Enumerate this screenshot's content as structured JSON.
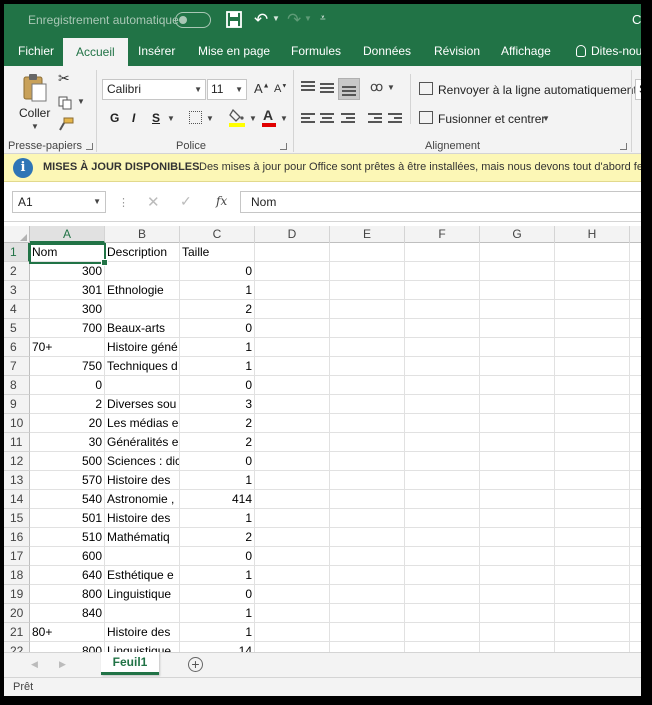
{
  "titlebar": {
    "autosave_label": "Enregistrement automatique",
    "title_partial": "C"
  },
  "tabs": [
    {
      "label": "Fichier",
      "active": false
    },
    {
      "label": "Accueil",
      "active": true
    },
    {
      "label": "Insérer",
      "active": false
    },
    {
      "label": "Mise en page",
      "active": false
    },
    {
      "label": "Formules",
      "active": false
    },
    {
      "label": "Données",
      "active": false
    },
    {
      "label": "Révision",
      "active": false
    },
    {
      "label": "Affichage",
      "active": false
    },
    {
      "label": "Dites-nou",
      "active": false
    }
  ],
  "ribbon": {
    "clipboard": {
      "paste_label": "Coller",
      "group_label": "Presse-papiers"
    },
    "font": {
      "font_name": "Calibri",
      "font_size": "11",
      "bold": "G",
      "italic": "I",
      "underline": "S",
      "group_label": "Police"
    },
    "alignment": {
      "wrap_label": "Renvoyer à la ligne automatiquement",
      "merge_label": "Fusionner et centrer",
      "group_label": "Alignement"
    },
    "number": {
      "format_partial": "S"
    }
  },
  "message_bar": {
    "title": "MISES À JOUR DISPONIBLES",
    "text": "Des mises à jour pour Office sont prêtes à être installées, mais nous devons tout d'abord fe"
  },
  "formula_bar": {
    "name_box": "A1",
    "content": "Nom"
  },
  "grid": {
    "columns": [
      "A",
      "B",
      "C",
      "D",
      "E",
      "F",
      "G",
      "H"
    ],
    "rows": [
      {
        "n": "1",
        "a": "Nom",
        "b": "Description",
        "c": "Taille"
      },
      {
        "n": "2",
        "a": "300",
        "b": "",
        "c": "0"
      },
      {
        "n": "3",
        "a": "301",
        "b": "Ethnologie",
        "c": "1"
      },
      {
        "n": "4",
        "a": "300",
        "b": "",
        "c": "2"
      },
      {
        "n": "5",
        "a": "700",
        "b": "Beaux-arts",
        "c": "0"
      },
      {
        "n": "6",
        "a": "70+",
        "b": "Histoire géné",
        "c": "1"
      },
      {
        "n": "7",
        "a": "750",
        "b": "Techniques d",
        "c": "1"
      },
      {
        "n": "8",
        "a": "0",
        "b": "",
        "c": "0"
      },
      {
        "n": "9",
        "a": "2",
        "b": "Diverses sou",
        "c": "3"
      },
      {
        "n": "10",
        "a": "20",
        "b": "Les médias e",
        "c": "2"
      },
      {
        "n": "11",
        "a": "30",
        "b": "Généralités e",
        "c": "2"
      },
      {
        "n": "12",
        "a": "500",
        "b": "Sciences : dic",
        "c": "0"
      },
      {
        "n": "13",
        "a": "570",
        "b": "Histoire des",
        "c": "1"
      },
      {
        "n": "14",
        "a": "540",
        "b": "Astronomie ,",
        "c": "414"
      },
      {
        "n": "15",
        "a": "501",
        "b": "Histoire des",
        "c": "1"
      },
      {
        "n": "16",
        "a": "510",
        "b": "Mathématiq",
        "c": "2"
      },
      {
        "n": "17",
        "a": "600",
        "b": "",
        "c": "0"
      },
      {
        "n": "18",
        "a": "640",
        "b": "Esthétique e",
        "c": "1"
      },
      {
        "n": "19",
        "a": "800",
        "b": "Linguistique",
        "c": "0"
      },
      {
        "n": "20",
        "a": "840",
        "b": "",
        "c": "1"
      },
      {
        "n": "21",
        "a": "80+",
        "b": "Histoire des",
        "c": "1"
      },
      {
        "n": "22",
        "a": "800",
        "b": "Linguistique",
        "c": "14"
      }
    ]
  },
  "sheets": [
    {
      "label": "Feuil1",
      "active": true
    }
  ],
  "status": {
    "text": "Prêt"
  },
  "colors": {
    "accent": "#217346",
    "message_bar": "#fcf7b6",
    "info_icon": "#2e75b6"
  }
}
